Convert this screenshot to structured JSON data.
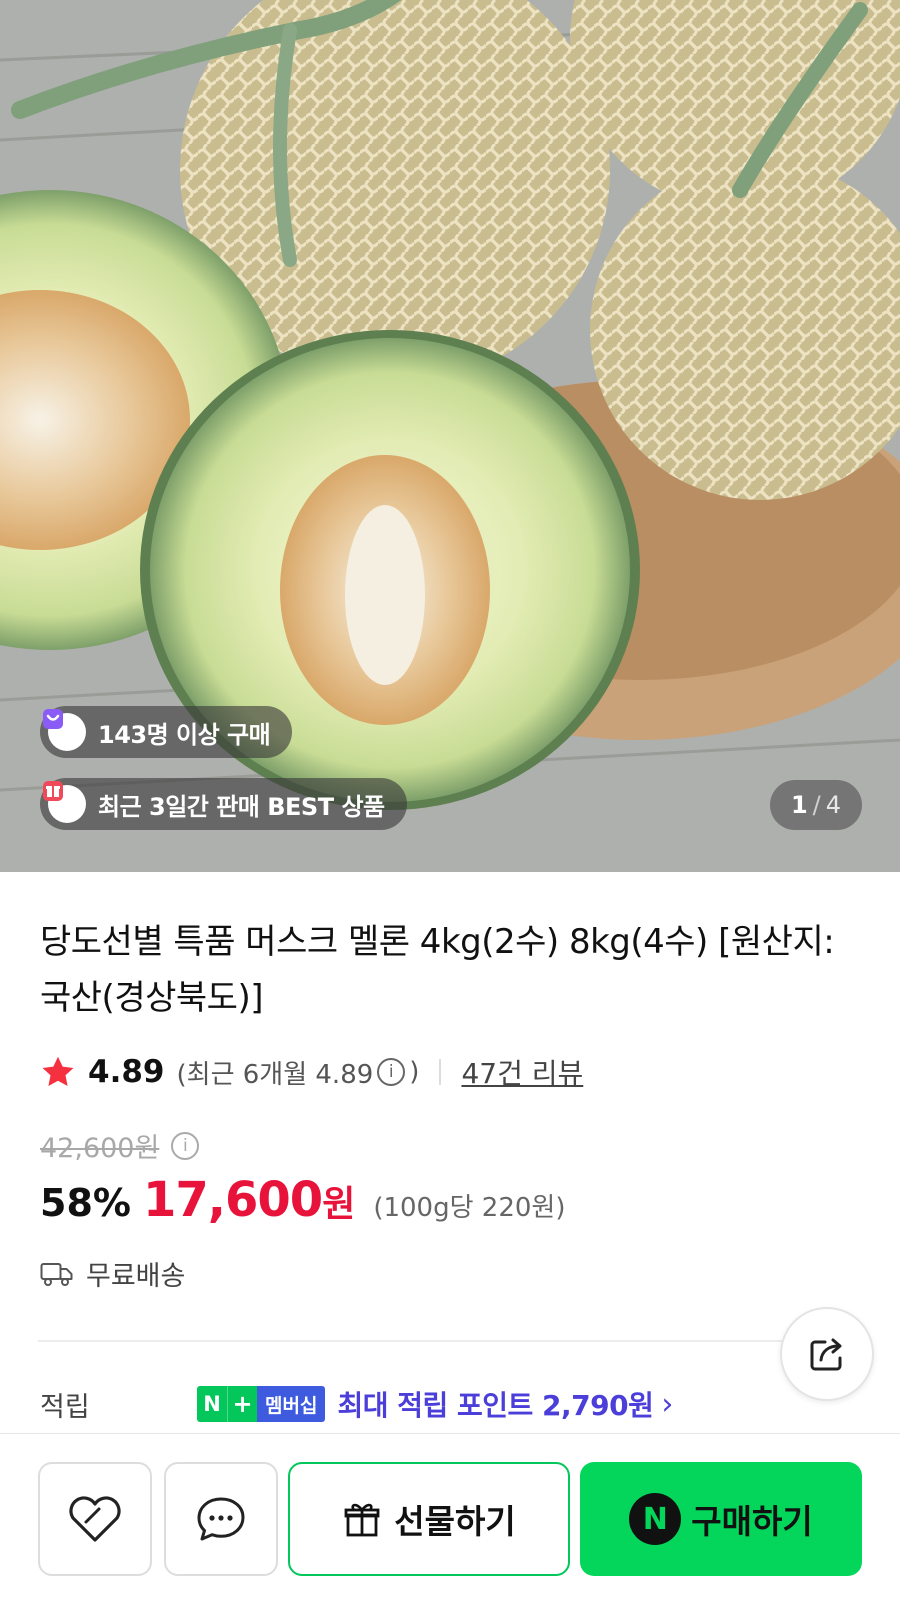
{
  "hero": {
    "badge_buyers": "143명 이상 구매",
    "badge_best": "최근 3일간 판매 BEST 상품",
    "image_index": "1",
    "image_separator": "/",
    "image_total": "4"
  },
  "product": {
    "title": "당도선별 특품 머스크 멜론 4kg(2수) 8kg(4수) [원산지:국산(경상북도)]",
    "rating": "4.89",
    "recent_prefix": "(최근 6개월 4.89",
    "recent_suffix": ")",
    "review_link": "47건 리뷰",
    "original_price": "42,600원",
    "discount_rate": "58%",
    "sale_price": "17,600",
    "currency": "원",
    "unit_price": "(100g당 220원)",
    "shipping": "무료배송"
  },
  "points": {
    "label": "적립",
    "badge_n": "N",
    "badge_plus": "+",
    "badge_label": "멤버십",
    "text": "최대 적립 포인트 2,790원",
    "chevron": "›"
  },
  "bottom": {
    "gift_label": "선물하기",
    "buy_badge": "N",
    "buy_label": "구매하기"
  },
  "colors": {
    "sale_red": "#e8133a",
    "naver_green": "#03c75a",
    "point_purple": "#4c3fd9",
    "membership_blue": "#3e5be0"
  },
  "icons": [
    "bag-icon",
    "gift-box-icon",
    "star-icon",
    "info-icon",
    "truck-icon",
    "share-icon",
    "heart-icon",
    "chat-icon",
    "gift-icon"
  ]
}
